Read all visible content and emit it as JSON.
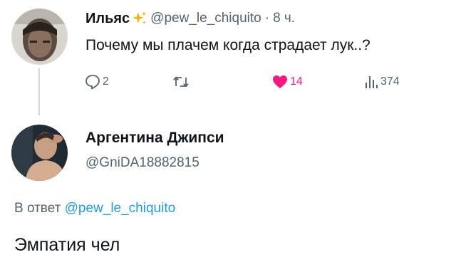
{
  "tweet": {
    "author_name": "Ильяс",
    "handle": "@pew_le_chiquito",
    "separator": "·",
    "time": "8 ч.",
    "text": "Почему мы плачем когда страдает лук..?",
    "reply_count": "2",
    "retweet_count": "",
    "like_count": "14",
    "view_count": "374"
  },
  "reply": {
    "author_name": "Аргентина Джипси",
    "handle": "@GniDA18882815",
    "reply_to_prefix": "В ответ",
    "reply_to_handle": "@pew_le_chiquito",
    "text": "Эмпатия чел"
  },
  "icons": {
    "sparkle": "sparkles-icon",
    "reply": "comment-bubble-icon",
    "retweet": "retweet-icon",
    "like": "heart-filled-icon",
    "views": "analytics-bars-icon"
  },
  "colors": {
    "text_primary": "#0f1419",
    "text_secondary": "#536471",
    "mention": "#1d9bf0",
    "like_active": "#f91880",
    "sparkle": "#f5b300",
    "thread_line": "#cfd9de"
  }
}
